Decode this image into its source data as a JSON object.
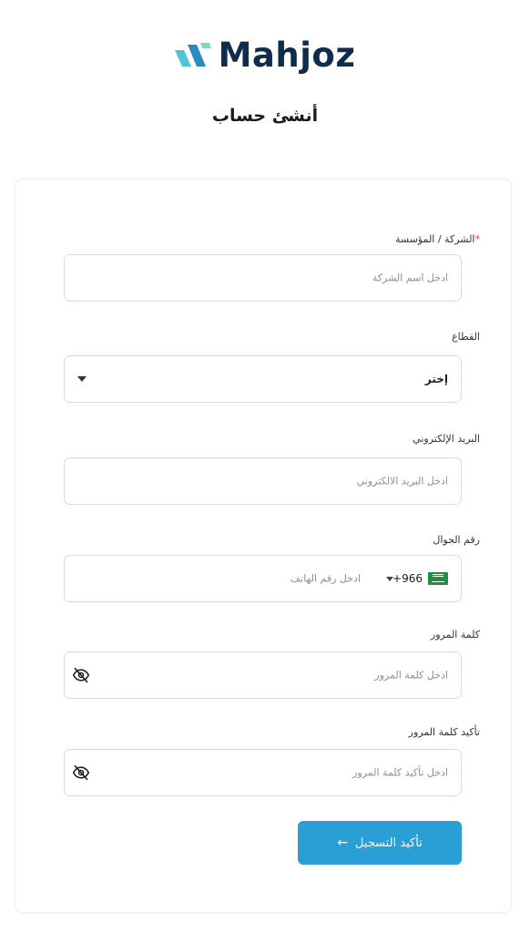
{
  "brand": {
    "name": "Mahjoz",
    "primary_color": "#0f2d4a",
    "accent_color": "#2a9fd6"
  },
  "page": {
    "title": "أنشئ حساب"
  },
  "form": {
    "company": {
      "label": "الشركة / المؤسسة",
      "required_mark": "*",
      "placeholder": "ادخل اسم الشركة"
    },
    "sector": {
      "label": "القطاع",
      "selected": "إختر",
      "icon": "caret-down-icon"
    },
    "email": {
      "label": "البريد الإلكتروني",
      "placeholder": "ادخل البريد الالكتروني"
    },
    "phone": {
      "label": "رقم الجوال",
      "country_code": "+966",
      "placeholder": "ادخل رقم الهاتف",
      "flag": "saudi-flag-icon"
    },
    "password": {
      "label": "كلمة المرور",
      "placeholder": "ادخل كلمة المرور",
      "icon": "eye-slash-icon"
    },
    "confirm_password": {
      "label": "تأكيد كلمة المرور",
      "placeholder": "ادخل تأكيد كلمة المرور",
      "icon": "eye-slash-icon"
    },
    "submit": {
      "label": "تأكيد التسجيل",
      "icon": "arrow-left-icon"
    }
  }
}
